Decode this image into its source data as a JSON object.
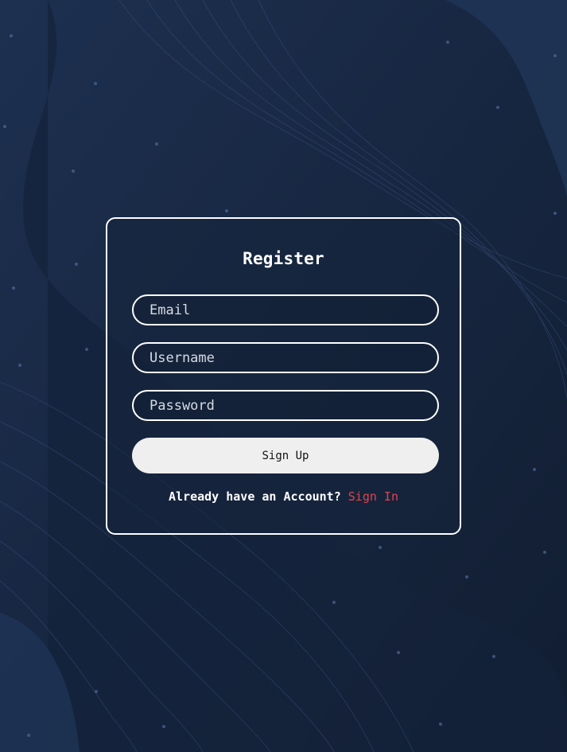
{
  "form": {
    "title": "Register",
    "email_placeholder": "Email",
    "username_placeholder": "Username",
    "password_placeholder": "Password",
    "signup_label": "Sign Up",
    "account_prompt": "Already have an Account?",
    "signin_label": "Sign In"
  },
  "colors": {
    "background": "#16243c",
    "card_border": "#ffffff",
    "button_bg": "#efefef",
    "link": "#e0454d"
  }
}
